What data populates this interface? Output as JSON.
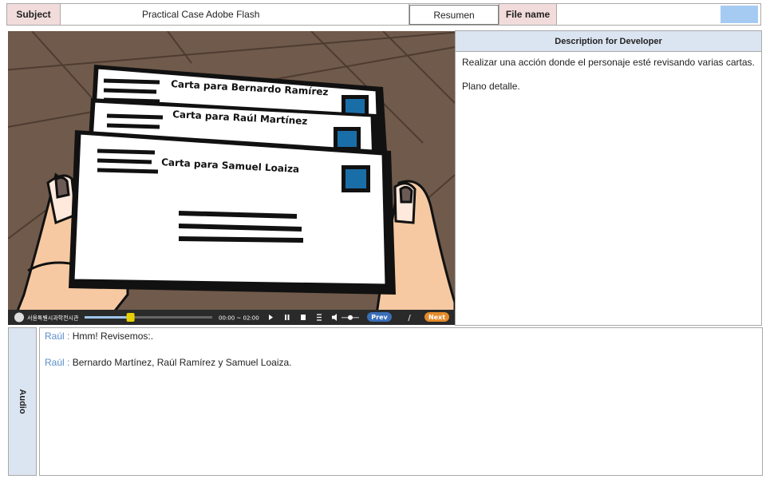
{
  "header": {
    "subject_label": "Subject",
    "subject_value": "Practical Case Adobe Flash",
    "resumen_button": "Resumen",
    "file_label": "File name",
    "file_value": ""
  },
  "scene": {
    "letters": [
      "Carta para Bernardo Ramírez",
      "Carta para Raúl Martínez",
      "Carta para Samuel Loaiza"
    ]
  },
  "player": {
    "logo_text": "서울특별시과학전시관",
    "time": "00:00 ~ 02:00",
    "prev_label": "Prev",
    "separator": "/",
    "next_label": "Next",
    "progress": 0.36
  },
  "description": {
    "header": "Description for Developer",
    "paragraphs": [
      "Realizar una acción donde el personaje esté revisando varias cartas.",
      "Plano detalle."
    ]
  },
  "audio": {
    "label": "Audio",
    "lines": [
      {
        "speaker": "Raúl",
        "sep": " : ",
        "text": "Hmm! Revisemos:."
      },
      {
        "speaker": "Raúl",
        "sep": " : ",
        "text": "Bernardo Martínez, Raúl Ramírez y Samuel Loaiza."
      }
    ]
  },
  "colors": {
    "label_pink": "#f2dcdb",
    "label_blue": "#dbe5f1",
    "speaker": "#5b8fc7",
    "stamp": "#1a6ea8"
  }
}
